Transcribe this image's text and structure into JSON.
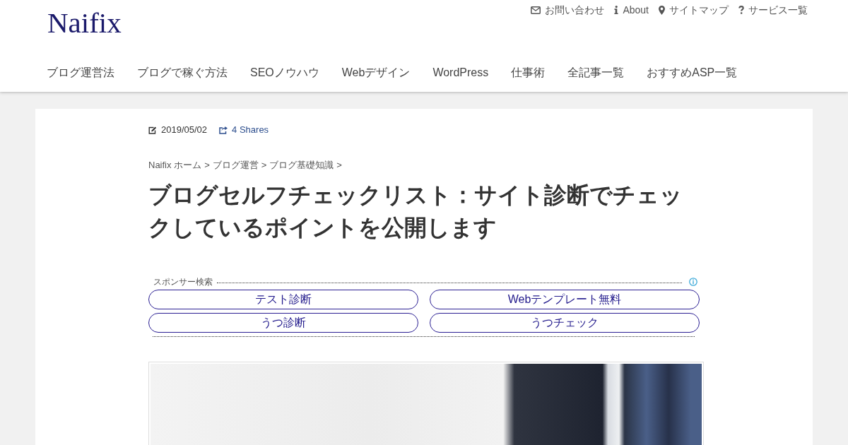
{
  "header": {
    "logo": "Naifix",
    "top_links": [
      "お問い合わせ",
      "About",
      "サイトマップ",
      "サービス一覧"
    ],
    "nav": [
      "ブログ運営法",
      "ブログで稼ぐ方法",
      "SEOノウハウ",
      "Webデザイン",
      "WordPress",
      "仕事術",
      "全記事一覧",
      "おすすめASP一覧"
    ]
  },
  "post": {
    "date": "2019/05/02",
    "shares": "4 Shares",
    "breadcrumb": [
      {
        "label": "Naifix ホーム",
        "separator": ">"
      },
      {
        "label": "ブログ運営",
        "separator": ">"
      },
      {
        "label": "ブログ基礎知識",
        "separator": ">"
      }
    ],
    "title": "ブログセルフチェックリスト：サイト診断でチェックしているポイントを公開します"
  },
  "sponsor": {
    "label": "スポンサー検索",
    "links": [
      "テスト診断",
      "Webテンプレート無料",
      "うつ診断",
      "うつチェック"
    ]
  }
}
